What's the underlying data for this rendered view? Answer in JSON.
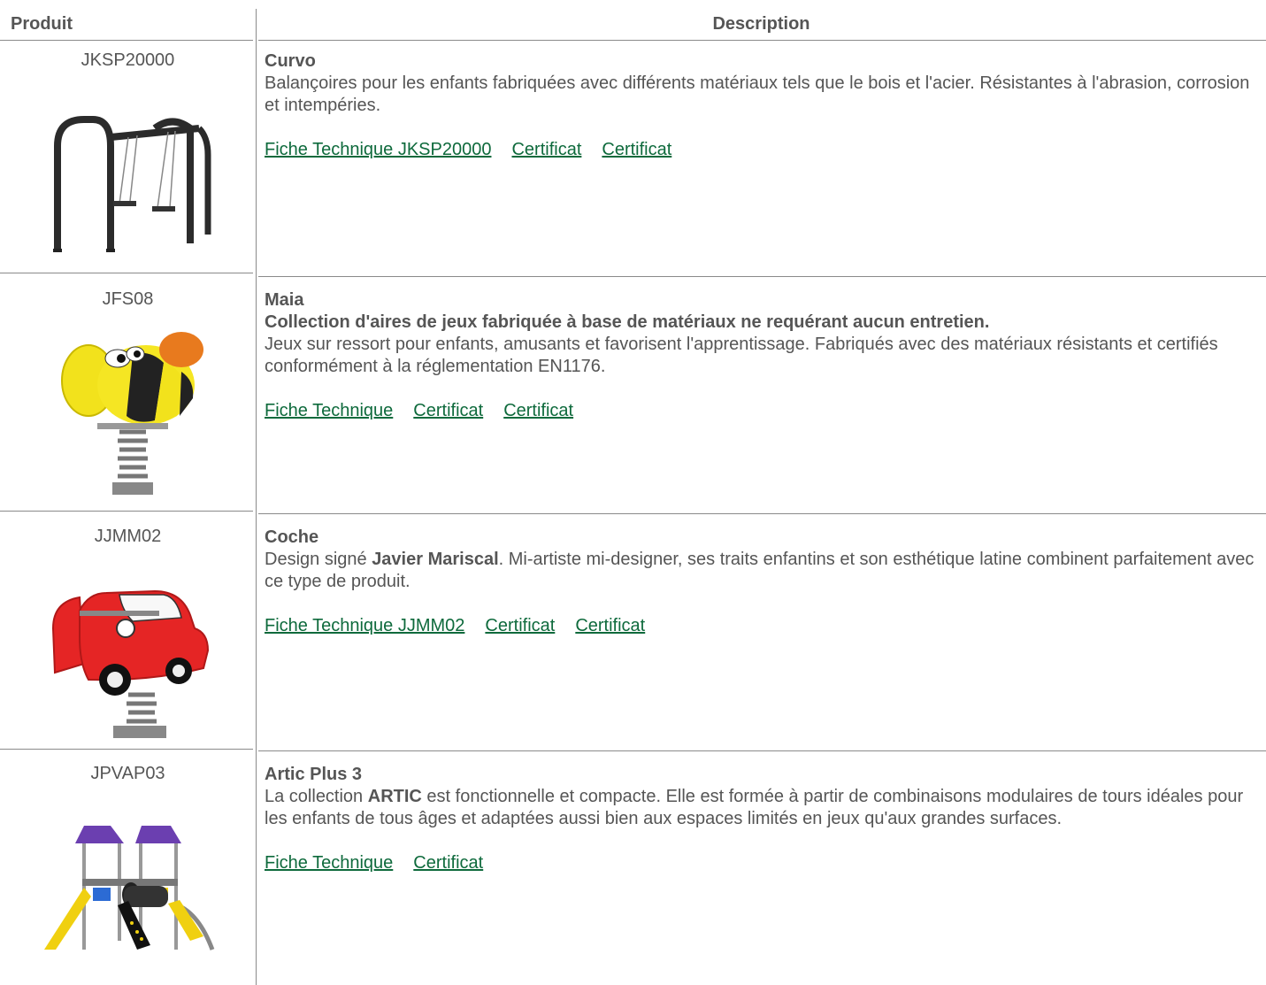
{
  "table": {
    "headers": {
      "product": "Produit",
      "description": "Description"
    },
    "rows": [
      {
        "code": "JKSP20000",
        "title": "Curvo",
        "subtitle": "",
        "text_before": "Balançoires pour les enfants fabriquées avec différents matériaux tels que le bois et l'acier. Résistantes à l'abrasion, corrosion et intempéries.",
        "bold_inline": "",
        "text_after": "",
        "links": [
          "Fiche Technique JKSP20000",
          "Certificat",
          "Certificat"
        ]
      },
      {
        "code": "JFS08",
        "title": "Maia",
        "subtitle": "Collection d'aires de jeux fabriquée à base de matériaux ne requérant aucun entretien.",
        "text_before": "Jeux sur ressort pour enfants, amusants et favorisent l'apprentissage. Fabriqués avec des matériaux résistants et certifiés conformément à la réglementation EN1176.",
        "bold_inline": "",
        "text_after": "",
        "links": [
          "Fiche Technique",
          "Certificat",
          "Certificat"
        ]
      },
      {
        "code": "JJMM02",
        "title": "Coche",
        "subtitle": "",
        "text_before": "Design signé ",
        "bold_inline": "Javier Mariscal",
        "text_after": ". Mi-artiste mi-designer, ses traits enfantins et son esthétique latine combinent parfaitement avec ce type de produit.",
        "links": [
          "Fiche Technique JJMM02",
          "Certificat",
          "Certificat"
        ]
      },
      {
        "code": "JPVAP03",
        "title": "Artic Plus 3",
        "subtitle": "",
        "text_before": "La collection ",
        "bold_inline": "ARTIC",
        "text_after": " est fonctionnelle et compacte. Elle est formée à partir de combinaisons modulaires de tours idéales pour les enfants de tous âges et adaptées aussi bien aux espaces limités en jeux qu'aux grandes surfaces.",
        "links": [
          "Fiche Technique",
          "Certificat"
        ]
      }
    ]
  }
}
